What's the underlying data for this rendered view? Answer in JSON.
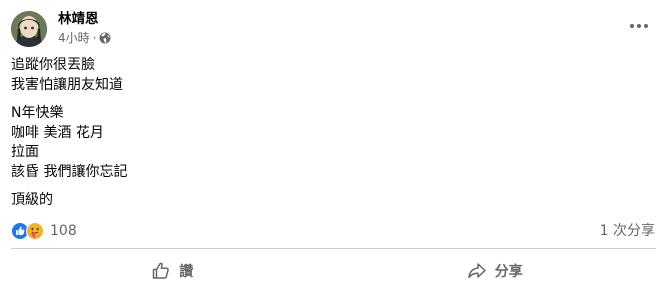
{
  "post": {
    "author": "林靖恩",
    "time": "4小時",
    "separator": "·",
    "paragraphs": [
      [
        "追蹤你很丟臉",
        "我害怕讓朋友知道"
      ],
      [
        "N年快樂",
        "咖啡 美酒 花月",
        "拉面",
        "該昏 我們讓你忘記"
      ],
      [
        "頂級的"
      ]
    ],
    "reactions": {
      "count": "108",
      "types": [
        "like-icon",
        "care-icon"
      ]
    },
    "shares": "1 次分享",
    "actions": {
      "like_label": "讚",
      "share_label": "分享"
    }
  },
  "colors": {
    "like_blue": "#1877f2",
    "care_yellow": "#f7b125",
    "secondary_text": "#65676b",
    "divider": "#ced0d4"
  }
}
